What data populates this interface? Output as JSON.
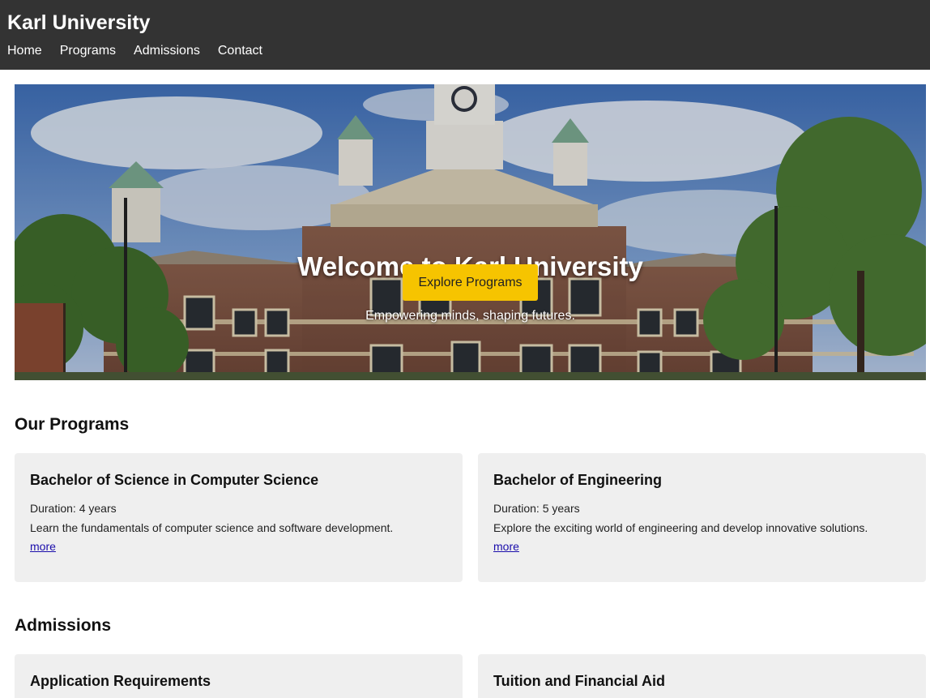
{
  "header": {
    "title": "Karl University",
    "nav": [
      "Home",
      "Programs",
      "Admissions",
      "Contact"
    ]
  },
  "hero": {
    "title": "Welcome to Karl University",
    "subtitle": "Empowering minds, shaping futures.",
    "button_label": "Explore Programs",
    "button_color": "#f6c400"
  },
  "programs": {
    "heading": "Our Programs",
    "items": [
      {
        "title": "Bachelor of Science in Computer Science",
        "duration": "Duration: 4 years",
        "description": "Learn the fundamentals of computer science and software development.",
        "link": "more"
      },
      {
        "title": "Bachelor of Engineering",
        "duration": "Duration: 5 years",
        "description": "Explore the exciting world of engineering and develop innovative solutions.",
        "link": "more"
      }
    ]
  },
  "admissions": {
    "heading": "Admissions",
    "items": [
      {
        "title": "Application Requirements"
      },
      {
        "title": "Tuition and Financial Aid"
      }
    ]
  },
  "colors": {
    "header_bg": "#333333",
    "card_bg": "#efefef",
    "link": "#1a0dab"
  }
}
